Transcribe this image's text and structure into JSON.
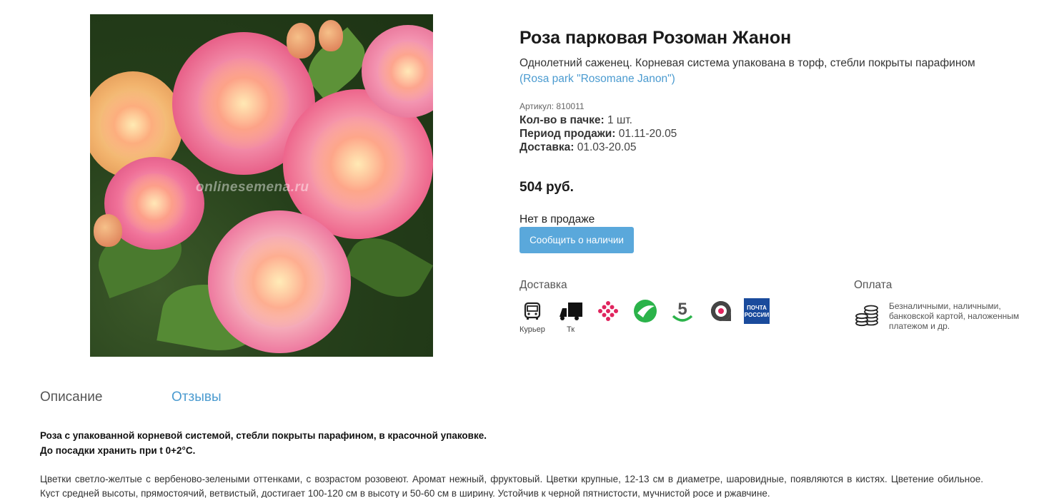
{
  "product": {
    "title": "Роза парковая Розоман Жанон",
    "subtitle": "Однолетний саженец. Корневая система упакована в торф, стебли покрыты парафином",
    "latin_name": "(Rosa park \"Rosomane Janon\")",
    "sku": "Артикул: 810011",
    "pack_qty_label": "Кол-во в пачке:",
    "pack_qty_value": "1 шт.",
    "sale_period_label": "Период продажи:",
    "sale_period_value": "01.11-20.05",
    "delivery_label": "Доставка:",
    "delivery_value": "01.03-20.05",
    "price": "504 руб.",
    "stock_status": "Нет в продаже",
    "notify_button": "Сообщить о наличии",
    "image_watermark": "onlinesemena.ru"
  },
  "delivery": {
    "heading": "Доставка",
    "methods": [
      {
        "icon": "bus-icon",
        "caption": "Курьер"
      },
      {
        "icon": "truck-icon",
        "caption": "Тк"
      },
      {
        "icon": "dots-cross-icon",
        "caption": ""
      },
      {
        "icon": "green-ball-icon",
        "caption": ""
      },
      {
        "icon": "five-icon",
        "caption": ""
      },
      {
        "icon": "record-icon",
        "caption": ""
      },
      {
        "icon": "pochta-rossii-icon",
        "caption": "ПОЧТА РОССИИ"
      }
    ]
  },
  "payment": {
    "heading": "Оплата",
    "icon": "coins-icon",
    "text": "Безналичными, наличными, банковской картой, наложенным платежом и др."
  },
  "tabs": [
    {
      "label": "Описание",
      "active": true
    },
    {
      "label": "Отзывы",
      "active": false
    }
  ],
  "description": {
    "bold_line_1": "Роза с упакованной корневой системой, стебли покрыты парафином, в красочной упаковке.",
    "bold_line_2": "До посадки хранить при t 0+2°C.",
    "body": "Цветки светло-желтые с вербеново-зелеными оттенками, с возрастом розовеют. Аромат нежный, фруктовый. Цветки крупные, 12-13 см в диаметре, шаровидные, появляются в кистях. Цветение обильное. Куст средней высоты, прямостоячий, ветвистый, достигает 100-120 см в высоту и 50-60 см в ширину. Устойчив к черной пятнистости, мучнистой росе и ржавчине."
  },
  "colors": {
    "accent_blue": "#5aa8db",
    "link_blue": "#4b9bd0",
    "pochta_blue": "#1a4b9c",
    "green": "#2bb34a"
  }
}
